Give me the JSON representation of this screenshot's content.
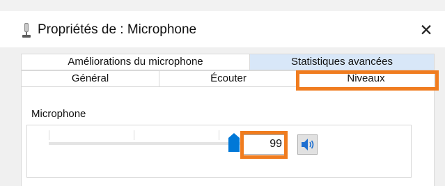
{
  "window": {
    "title": "Propriétés de : Microphone",
    "close_glyph": "✕"
  },
  "tabs": {
    "back_row": [
      {
        "label": "Améliorations du microphone",
        "selected": false
      },
      {
        "label": "Statistiques avancées",
        "selected": false
      }
    ],
    "front_row": [
      {
        "label": "Général",
        "selected": false
      },
      {
        "label": "Écouter",
        "selected": false
      },
      {
        "label": "Niveaux",
        "selected": true
      }
    ]
  },
  "levels": {
    "group_label": "Microphone",
    "slider_level_percent": 99,
    "value": "99",
    "speaker_icon": "speaker-icon"
  },
  "colors": {
    "highlight": "#f07c1f",
    "selected_tab_back": "#d8e7f8",
    "accent_blue": "#0078d7"
  }
}
